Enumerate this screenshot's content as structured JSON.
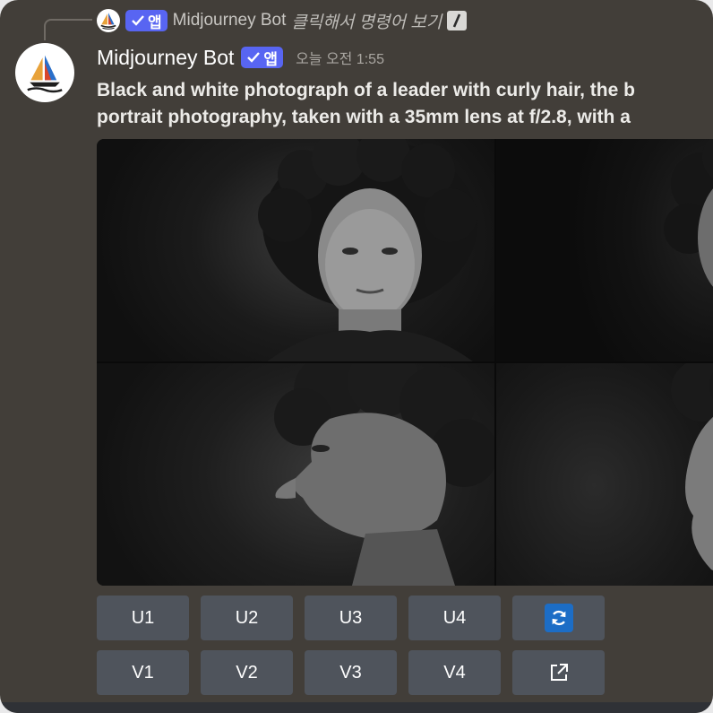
{
  "reply": {
    "bot_name": "Midjourney Bot",
    "app_badge": "앱",
    "command_hint": "클릭해서 명령어 보기"
  },
  "message": {
    "author": "Midjourney Bot",
    "app_badge": "앱",
    "timestamp": "오늘 오전 1:55",
    "prompt_line1": "Black and white photograph of a leader with curly hair, the b",
    "prompt_line2": "portrait photography, taken with a 35mm lens at f/2.8, with a"
  },
  "image_grid": {
    "panels": [
      "portrait-1",
      "portrait-2",
      "portrait-3",
      "portrait-4"
    ]
  },
  "buttons": {
    "upscale": [
      "U1",
      "U2",
      "U3",
      "U4"
    ],
    "variation": [
      "V1",
      "V2",
      "V3",
      "V4"
    ],
    "reroll_icon": "refresh-icon",
    "open_icon": "external-link-icon"
  },
  "colors": {
    "background": "#423e39",
    "badge": "#5865f2",
    "button": "#4f545c",
    "reroll_accent": "#1c6dc6"
  }
}
